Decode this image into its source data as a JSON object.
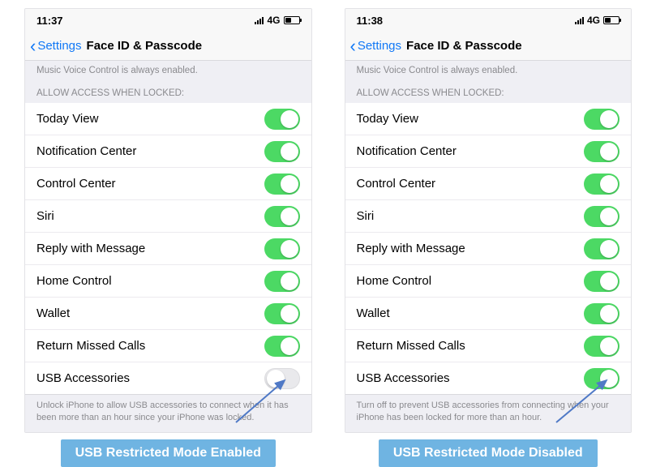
{
  "phones": [
    {
      "status": {
        "time": "11:37",
        "network": "4G"
      },
      "nav": {
        "back": "Settings",
        "title": "Face ID & Passcode"
      },
      "sub_note": "Music Voice Control is always enabled.",
      "section_header": "ALLOW ACCESS WHEN LOCKED:",
      "rows": [
        {
          "label": "Today View",
          "on": true
        },
        {
          "label": "Notification Center",
          "on": true
        },
        {
          "label": "Control Center",
          "on": true
        },
        {
          "label": "Siri",
          "on": true
        },
        {
          "label": "Reply with Message",
          "on": true
        },
        {
          "label": "Home Control",
          "on": true
        },
        {
          "label": "Wallet",
          "on": true
        },
        {
          "label": "Return Missed Calls",
          "on": true
        },
        {
          "label": "USB Accessories",
          "on": false
        }
      ],
      "footer": "Unlock iPhone to allow USB accessories to connect when it has been more than an hour since your iPhone was locked.",
      "caption": "USB Restricted Mode Enabled"
    },
    {
      "status": {
        "time": "11:38",
        "network": "4G"
      },
      "nav": {
        "back": "Settings",
        "title": "Face ID & Passcode"
      },
      "sub_note": "Music Voice Control is always enabled.",
      "section_header": "ALLOW ACCESS WHEN LOCKED:",
      "rows": [
        {
          "label": "Today View",
          "on": true
        },
        {
          "label": "Notification Center",
          "on": true
        },
        {
          "label": "Control Center",
          "on": true
        },
        {
          "label": "Siri",
          "on": true
        },
        {
          "label": "Reply with Message",
          "on": true
        },
        {
          "label": "Home Control",
          "on": true
        },
        {
          "label": "Wallet",
          "on": true
        },
        {
          "label": "Return Missed Calls",
          "on": true
        },
        {
          "label": "USB Accessories",
          "on": true
        }
      ],
      "footer": "Turn off to prevent USB accessories from connecting when your iPhone has been locked for more than an hour.",
      "caption": "USB Restricted Mode Disabled"
    }
  ]
}
